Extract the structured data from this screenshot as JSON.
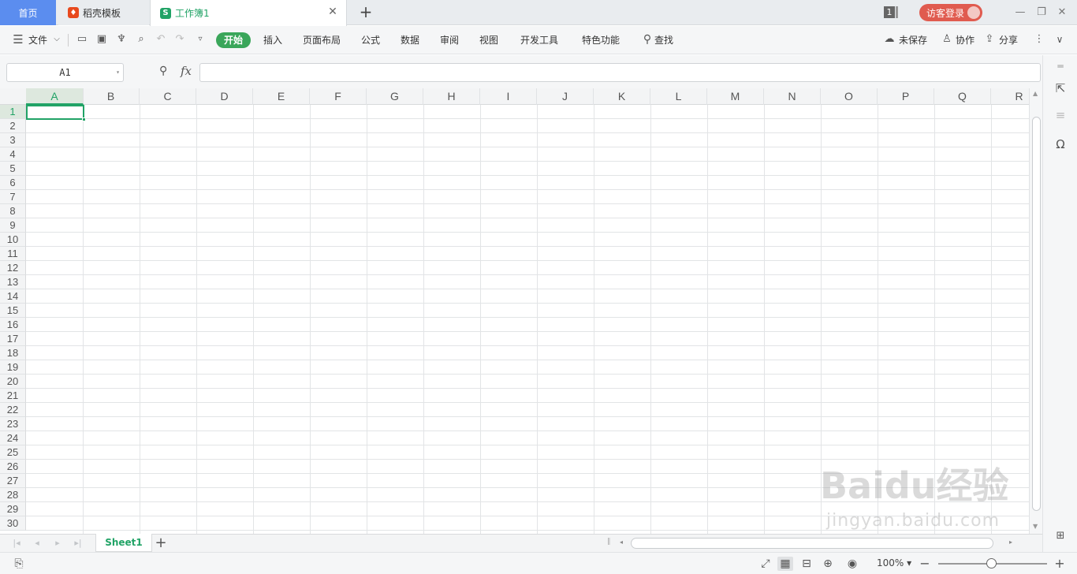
{
  "tabs": {
    "home": "首页",
    "template": "稻壳模板",
    "workbook": "工作簿1",
    "template_icon_color": "#e8491d",
    "workbook_icon_color": "#21a366"
  },
  "titlebar": {
    "doc_count": "1",
    "login_label": "访客登录"
  },
  "menu": {
    "file": "文件",
    "tabs": [
      "开始",
      "插入",
      "页面布局",
      "公式",
      "数据",
      "审阅",
      "视图",
      "开发工具",
      "特色功能"
    ],
    "search": "查找",
    "unsaved": "未保存",
    "collaborate": "协作",
    "share": "分享"
  },
  "formula_bar": {
    "name_box": "A1",
    "fx": "fx",
    "formula": ""
  },
  "grid": {
    "columns": [
      "A",
      "B",
      "C",
      "D",
      "E",
      "F",
      "G",
      "H",
      "I",
      "J",
      "K",
      "L",
      "M",
      "N",
      "O",
      "P",
      "Q",
      "R"
    ],
    "rows": [
      "1",
      "2",
      "3",
      "4",
      "5",
      "6",
      "7",
      "8",
      "9",
      "10",
      "11",
      "12",
      "13",
      "14",
      "15",
      "16",
      "17",
      "18",
      "19",
      "20",
      "21",
      "22",
      "23",
      "24",
      "25",
      "26",
      "27",
      "28",
      "29",
      "30"
    ],
    "selected": "A1"
  },
  "sheets": {
    "tabs": [
      "Sheet1"
    ],
    "active": "Sheet1"
  },
  "status": {
    "zoom": "100%",
    "zoom_level": 1.0
  },
  "watermark": {
    "main": "Baidu经验",
    "sub": "jingyan.baidu.com"
  },
  "colors": {
    "accent": "#21a366",
    "home_tab": "#5b8def",
    "login": "#e05b4f"
  }
}
